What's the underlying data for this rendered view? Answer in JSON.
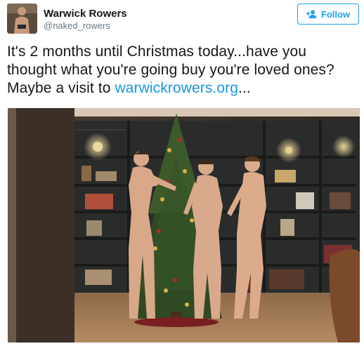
{
  "tweet": {
    "author": {
      "display_name": "Warwick Rowers",
      "handle": "@naked_rowers",
      "avatar_icon": "profile-photo"
    },
    "follow_button": {
      "label": "Follow",
      "icon": "add-user-icon",
      "color": "#1da1f2"
    },
    "text_before_link": "It's 2 months until Christmas today...have you thought what you're going buy you're loved ones? Maybe a visit to ",
    "link_text": "warwickrowers.org",
    "text_after_link": "...",
    "link_color": "#1b95e0"
  },
  "media": {
    "photo_icon": "christmas-tree-photo"
  }
}
